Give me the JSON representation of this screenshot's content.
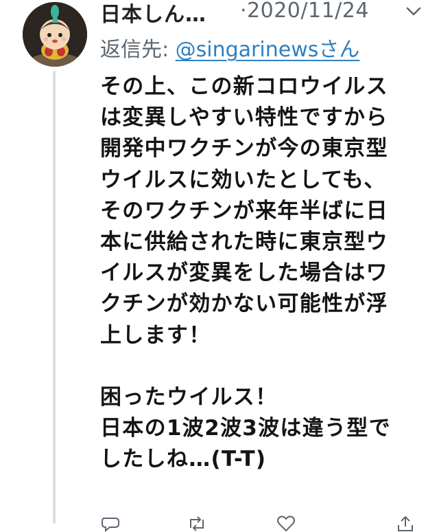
{
  "tweet": {
    "author": {
      "display_name": "日本しん…",
      "avatar_icon": "avatar-figure-icon"
    },
    "timestamp": "·2020/11/24",
    "more_icon": "chevron-down-icon",
    "reply_to": {
      "prefix": "返信先: ",
      "handle": "@singarinewsさん"
    },
    "body_lines": [
      "その上、この新コロウイルス",
      "は変異しやすい特性ですから",
      "開発中ワクチンが今の東京型",
      "ウイルスに効いたとしても、",
      "そのワクチンが来年半ばに日",
      "本に供給された時に東京型ウ",
      "イルスが変異をした場合はワ",
      "クチンが効かない可能性が浮",
      "上します！",
      "",
      "困ったウイルス！",
      "日本の1波2波3波は違う型で",
      "したしね…(T-T)"
    ],
    "actions": [
      {
        "name": "reply-button",
        "icon": "reply-icon"
      },
      {
        "name": "retweet-button",
        "icon": "retweet-icon"
      },
      {
        "name": "like-button",
        "icon": "heart-icon"
      },
      {
        "name": "share-button",
        "icon": "share-icon"
      }
    ]
  },
  "colors": {
    "link": "#2f7fc1",
    "secondary_text": "#5b6670",
    "thread_line": "#d9dee3"
  }
}
